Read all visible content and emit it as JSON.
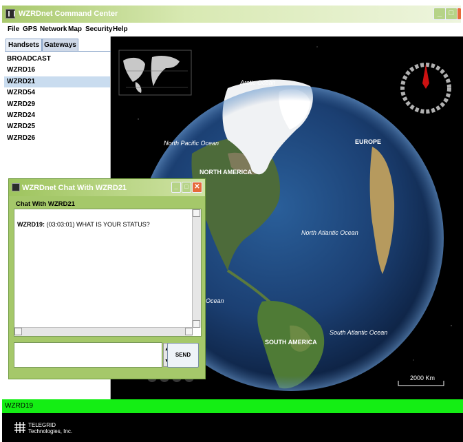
{
  "window": {
    "title": "WZRDnet Command Center"
  },
  "menu": [
    "File",
    "GPS",
    "Network",
    "Map",
    "Security",
    "Help"
  ],
  "tabs": [
    "Handsets",
    "Gateways"
  ],
  "handsets": [
    "BROADCAST",
    "WZRD16",
    "WZRD21",
    "WZRD54",
    "WZRD29",
    "WZRD24",
    "WZRD25",
    "WZRD26"
  ],
  "selected_handset": "WZRD21",
  "chat": {
    "title": "WZRDnet Chat With WZRD21",
    "label": "Chat With WZRD21",
    "message_sender": "WZRD19:",
    "message_text": "(03:03:01) WHAT IS YOUR STATUS?",
    "input_value": "",
    "send_label": "SEND"
  },
  "map": {
    "labels": {
      "arctic": "Arctic Ocean",
      "north_pacific": "North Pacific Ocean",
      "europe": "EUROPE",
      "north_america": "NORTH AMERICA",
      "north_atlantic": "North Atlantic Ocean",
      "ocean": "Ocean",
      "south_america": "SOUTH AMERICA",
      "south_atlantic": "South Atlantic Ocean"
    },
    "scale": "2000 Km"
  },
  "status": {
    "text": "WZRD19",
    "color": "#14ee14"
  },
  "footer": {
    "line1": "TELEGRID",
    "line2": "Technologies, Inc."
  },
  "colors": {
    "titlebar": "#a8c86c",
    "selection": "#c9dcef",
    "compass_needle": "#cc1111"
  }
}
